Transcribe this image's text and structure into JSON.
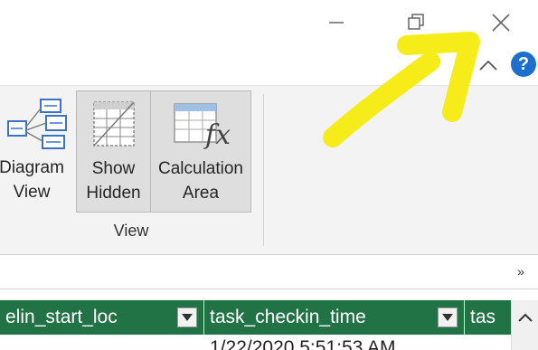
{
  "window": {
    "minimize_icon": "minimize-icon",
    "maximize_icon": "restore-icon",
    "close_icon": "close-icon"
  },
  "ribbon": {
    "collapse_icon": "chevron-up-icon",
    "help_label": "?",
    "groups": [
      {
        "label": "View",
        "buttons": [
          {
            "line1": "Diagram",
            "line2": "View",
            "icon": "diagram-view-icon",
            "selected": false
          },
          {
            "line1": "Show",
            "line2": "Hidden",
            "icon": "show-hidden-icon",
            "selected": true
          },
          {
            "line1": "Calculation",
            "line2": "Area",
            "icon": "calculation-area-icon",
            "selected": true
          }
        ]
      }
    ]
  },
  "formula_bar": {
    "expand_label": "»"
  },
  "grid": {
    "columns": [
      "elin_start_loc",
      "task_checkin_time",
      "tas"
    ],
    "rows": [
      [
        "",
        "1/22/2020 5:51:53 AM",
        ""
      ]
    ],
    "header_color": "#217346"
  },
  "annotation": {
    "color": "#f5ec1a",
    "shape": "arrow"
  }
}
